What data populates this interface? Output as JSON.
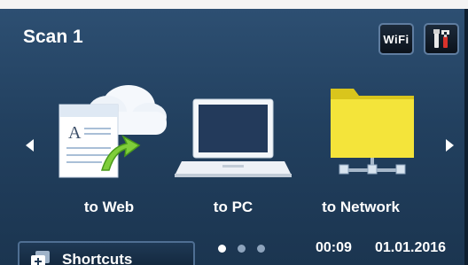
{
  "header": {
    "title": "Scan 1",
    "wifi_label": "WiFi"
  },
  "functions": [
    {
      "label": "to Web",
      "icon": "cloud-upload-icon"
    },
    {
      "label": "to PC",
      "icon": "laptop-icon"
    },
    {
      "label": "to Network",
      "icon": "network-folder-icon"
    }
  ],
  "footer": {
    "shortcuts_label": "Shortcuts",
    "page_indicator": {
      "current": 1,
      "total": 3
    },
    "time": "00:09",
    "date": "01.01.2016"
  },
  "colors": {
    "background": "#22405f",
    "folder_yellow": "#f2e12a",
    "cloud_white": "#f5f8fc"
  }
}
